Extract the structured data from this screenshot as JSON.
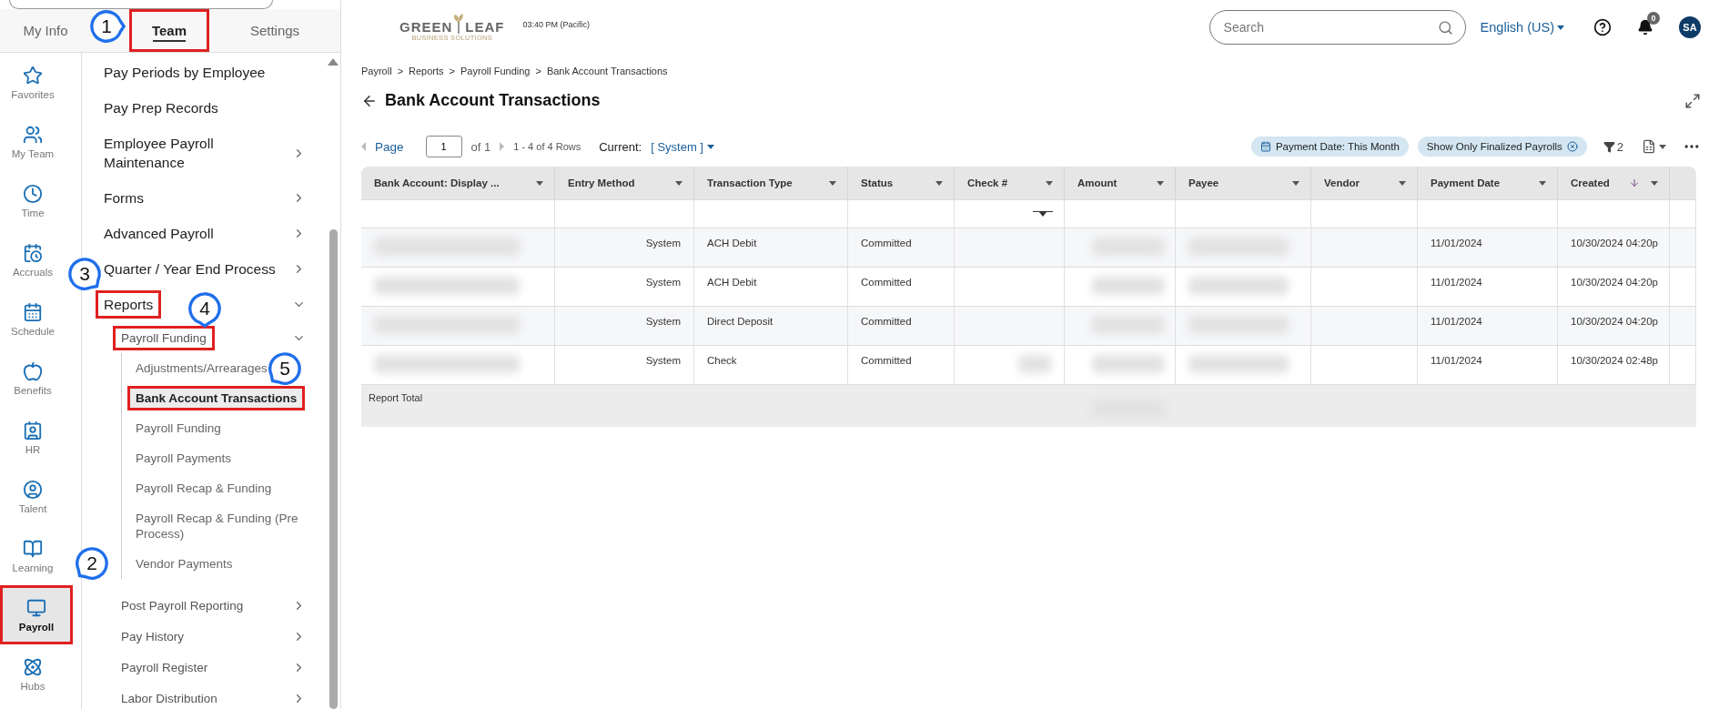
{
  "left_tabs": [
    {
      "label": "My Info",
      "selected": false,
      "boxed": false
    },
    {
      "label": "Team",
      "selected": true,
      "boxed": true
    },
    {
      "label": "Settings",
      "selected": false,
      "boxed": false
    }
  ],
  "rail": [
    {
      "label": "Favorites",
      "selected": false,
      "boxed": false
    },
    {
      "label": "My Team",
      "selected": false,
      "boxed": false
    },
    {
      "label": "Time",
      "selected": false,
      "boxed": false
    },
    {
      "label": "Accruals",
      "selected": false,
      "boxed": false
    },
    {
      "label": "Schedule",
      "selected": false,
      "boxed": false
    },
    {
      "label": "Benefits",
      "selected": false,
      "boxed": false
    },
    {
      "label": "HR",
      "selected": false,
      "boxed": false
    },
    {
      "label": "Talent",
      "selected": false,
      "boxed": false
    },
    {
      "label": "Learning",
      "selected": false,
      "boxed": false
    },
    {
      "label": "Payroll",
      "selected": true,
      "boxed": true
    },
    {
      "label": "Hubs",
      "selected": false,
      "boxed": false
    }
  ],
  "menu": [
    {
      "label": "Pay Periods by Employee",
      "kind": "link",
      "selected": false,
      "boxed": false
    },
    {
      "label": "Pay Prep Records",
      "kind": "link",
      "selected": false,
      "boxed": false
    },
    {
      "label": "Employee Payroll Maintenance",
      "kind": "folder",
      "expanded": false,
      "boxed": false
    },
    {
      "label": "Forms",
      "kind": "folder",
      "expanded": false,
      "boxed": false
    },
    {
      "label": "Advanced Payroll",
      "kind": "folder",
      "expanded": false,
      "boxed": false
    },
    {
      "label": "Quarter / Year End Process",
      "kind": "folder",
      "expanded": false,
      "boxed": false
    },
    {
      "label": "Reports",
      "kind": "folder",
      "expanded": true,
      "boxed": true,
      "children": [
        {
          "label": "Payroll Funding",
          "kind": "folder",
          "expanded": true,
          "boxed": true,
          "children": [
            {
              "label": "Adjustments/Arrearages",
              "kind": "link",
              "selected": false,
              "boxed": false
            },
            {
              "label": "Bank Account Transactions",
              "kind": "link",
              "selected": true,
              "boxed": true
            },
            {
              "label": "Payroll Funding",
              "kind": "link",
              "selected": false,
              "boxed": false
            },
            {
              "label": "Payroll Payments",
              "kind": "link",
              "selected": false,
              "boxed": false
            },
            {
              "label": "Payroll Recap & Funding",
              "kind": "link",
              "selected": false,
              "boxed": false
            },
            {
              "label": "Payroll Recap & Funding (Pre Process)",
              "kind": "link",
              "selected": false,
              "boxed": false
            },
            {
              "label": "Vendor Payments",
              "kind": "link",
              "selected": false,
              "boxed": false
            }
          ]
        },
        {
          "label": "Post Payroll Reporting",
          "kind": "folder",
          "expanded": false,
          "boxed": false
        },
        {
          "label": "Pay History",
          "kind": "folder",
          "expanded": false,
          "boxed": false
        },
        {
          "label": "Payroll Register",
          "kind": "folder",
          "expanded": false,
          "boxed": false
        },
        {
          "label": "Labor Distribution",
          "kind": "folder",
          "expanded": false,
          "boxed": false
        }
      ]
    }
  ],
  "callouts": [
    "1",
    "2",
    "3",
    "4",
    "5"
  ],
  "header": {
    "logo": {
      "word_1": "GREEN",
      "word_2": "LEAF",
      "tagline": "BUSINESS SOLUTIONS"
    },
    "time": "03:40 PM (Pacific)",
    "search": {
      "placeholder": "Search"
    },
    "language": "English (US)",
    "notifications": "0",
    "avatar": "SA"
  },
  "breadcrumb": [
    "Payroll",
    "Reports",
    "Payroll Funding",
    "Bank Account Transactions"
  ],
  "breadcrumb_separator": ">",
  "title": "Bank Account Transactions",
  "pager": {
    "page_label": "Page",
    "page": "1",
    "of": "of 1",
    "rows": "1 - 4 of 4 Rows",
    "current_label": "Current:",
    "current_value": "[ System ]"
  },
  "filters": [
    {
      "label": "Payment Date: This Month",
      "kind": "date"
    },
    {
      "label": "Show Only Finalized Payrolls",
      "kind": "removable"
    }
  ],
  "filter_count": "2",
  "table": {
    "columns": [
      {
        "label": "Bank Account: Display ...",
        "sorted": false
      },
      {
        "label": "Entry Method",
        "sorted": false
      },
      {
        "label": "Transaction Type",
        "sorted": false
      },
      {
        "label": "Status",
        "sorted": false
      },
      {
        "label": "Check #",
        "sorted": false
      },
      {
        "label": "Amount",
        "sorted": false
      },
      {
        "label": "Payee",
        "sorted": false
      },
      {
        "label": "Vendor",
        "sorted": false
      },
      {
        "label": "Payment Date",
        "sorted": false
      },
      {
        "label": "Created",
        "sorted": true
      }
    ],
    "rows": [
      {
        "entry_method": "System",
        "transaction_type": "ACH Debit",
        "status": "Committed",
        "check_blurred": false,
        "payment_date": "11/01/2024",
        "created": "10/30/2024 04:20p"
      },
      {
        "entry_method": "System",
        "transaction_type": "ACH Debit",
        "status": "Committed",
        "check_blurred": false,
        "payment_date": "11/01/2024",
        "created": "10/30/2024 04:20p"
      },
      {
        "entry_method": "System",
        "transaction_type": "Direct Deposit",
        "status": "Committed",
        "check_blurred": false,
        "payment_date": "11/01/2024",
        "created": "10/30/2024 04:20p"
      },
      {
        "entry_method": "System",
        "transaction_type": "Check",
        "status": "Committed",
        "check_blurred": true,
        "payment_date": "11/01/2024",
        "created": "10/30/2024 02:48p"
      }
    ],
    "footer_label": "Report Total"
  }
}
